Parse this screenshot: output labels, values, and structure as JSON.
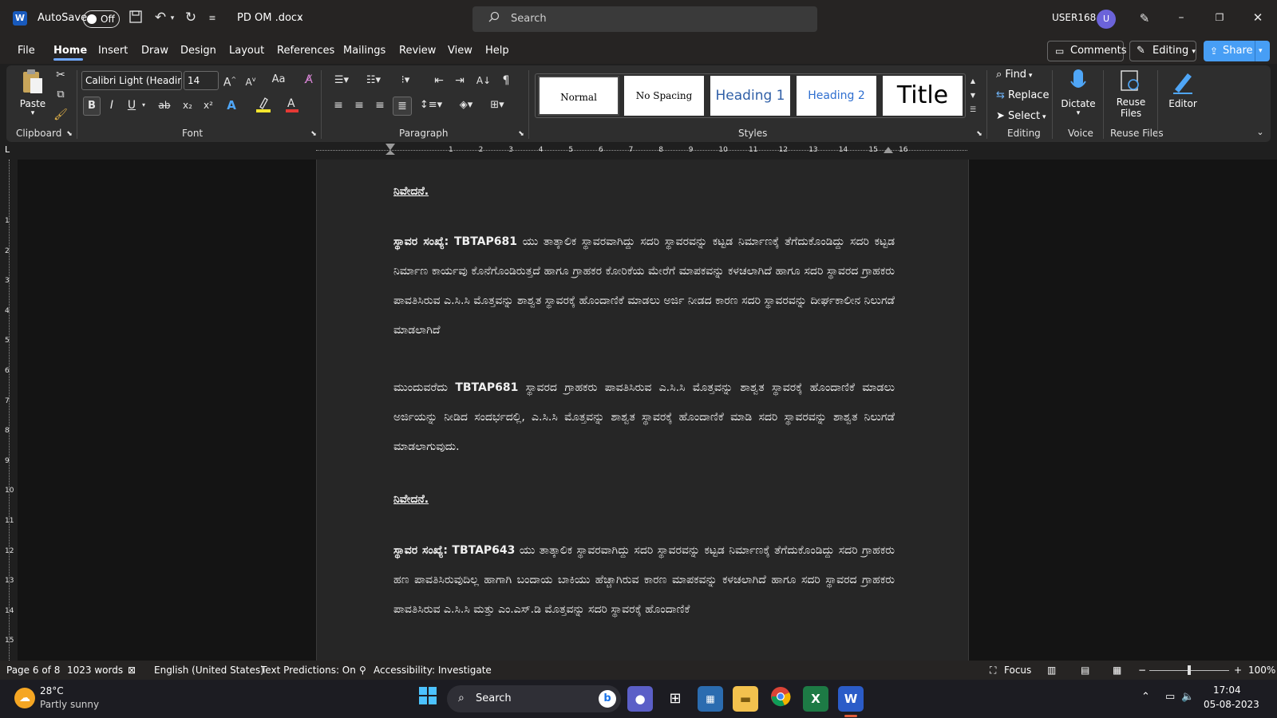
{
  "titlebar": {
    "autosave_label": "AutoSave",
    "autosave_state": "Off",
    "doc_title": "PD OM .docx",
    "search_placeholder": "Search",
    "user": "USER168",
    "avatar_initial": "U"
  },
  "tabs": [
    "File",
    "Home",
    "Insert",
    "Draw",
    "Design",
    "Layout",
    "References",
    "Mailings",
    "Review",
    "View",
    "Help"
  ],
  "active_tab": "Home",
  "top_buttons": {
    "comments": "Comments",
    "editing": "Editing",
    "share": "Share"
  },
  "ribbon": {
    "clipboard": {
      "paste": "Paste",
      "group": "Clipboard"
    },
    "font": {
      "name": "Calibri Light (Headir",
      "size": "14",
      "group": "Font",
      "bold": "B",
      "italic": "I",
      "underline": "U",
      "strike": "ab",
      "sub": "x₂",
      "sup": "x²",
      "aa": "Aa"
    },
    "paragraph": {
      "group": "Paragraph"
    },
    "styles": {
      "items": [
        "Normal",
        "No Spacing",
        "Heading 1",
        "Heading 2",
        "Title"
      ],
      "group": "Styles"
    },
    "editing": {
      "find": "Find",
      "replace": "Replace",
      "select": "Select",
      "group": "Editing"
    },
    "voice": {
      "dictate": "Dictate",
      "group": "Voice"
    },
    "reuse": {
      "label1": "Reuse",
      "label2": "Files",
      "group": "Reuse Files"
    },
    "editor": {
      "label": "Editor"
    }
  },
  "ruler": {
    "numbers": [
      "1",
      "2",
      "3",
      "4",
      "5",
      "6",
      "7",
      "8",
      "9",
      "10",
      "11",
      "12",
      "13",
      "14",
      "15",
      "16"
    ],
    "vnumbers": [
      "1",
      "2",
      "3",
      "4",
      "5",
      "6",
      "7",
      "8",
      "9",
      "10",
      "11",
      "12",
      "13",
      "14",
      "15"
    ]
  },
  "document": {
    "heading1": "ನಿವೇದನೆ.",
    "para1_lead": "ಸ್ಥಾವರ ಸಂಖ್ಯೆ:",
    "para1_code": "TBTAP681",
    "para1_text": "ಯು ತಾತ್ಕಾಲಿಕ ಸ್ಥಾವರವಾಗಿದ್ದು ಸದರಿ ಸ್ಥಾವರವನ್ನು ಕಟ್ಟಡ ನಿರ್ಮಾಣಕ್ಕೆ ತೆಗೆದುಕೊಂಡಿದ್ದು ಸದರಿ ಕಟ್ಟಡ ನಿರ್ಮಾಣ ಕಾರ್ಯವು ಕೊನೆಗೊಂಡಿರುತ್ತದೆ ಹಾಗೂ ಗ್ರಾಹಕರ ಕೋರಿಕೆಯ ಮೇರೆಗೆ ಮಾಪಕವನ್ನು ಕಳಚಲಾಗಿದೆ ಹಾಗೂ ಸದರಿ ಸ್ಥಾವರದ ಗ್ರಾಹಕರು ಪಾವತಿಸಿರುವ ಎ.ಸಿ.ಸಿ ಮೊತ್ತವನ್ನು ಶಾಶ್ವತ ಸ್ಥಾವರಕ್ಕೆ ಹೊಂದಾಣಿಕೆ ಮಾಡಲು ಅರ್ಜಿ ನೀಡದ ಕಾರಣ ಸದರಿ ಸ್ಥಾವರವನ್ನು ದೀರ್ಘಕಾಲೀನ ನಿಲುಗಡೆ ಮಾಡಲಾಗಿದೆ",
    "para2_lead": "ಮುಂದುವರೆದು",
    "para2_code": "TBTAP681",
    "para2_text": "ಸ್ಥಾವರದ ಗ್ರಾಹಕರು ಪಾವತಿಸಿರುವ ಎ.ಸಿ.ಸಿ ಮೊತ್ತವನ್ನು ಶಾಶ್ವತ ಸ್ಥಾವರಕ್ಕೆ ಹೊಂದಾಣಿಕೆ ಮಾಡಲು ಅರ್ಜಿಯನ್ನು ನೀಡಿದ ಸಂದರ್ಭದಲ್ಲಿ, ಎ.ಸಿ.ಸಿ ಮೊತ್ತವನ್ನು ಶಾಶ್ವತ ಸ್ಥಾವರಕ್ಕೆ ಹೊಂದಾಣಿಕೆ ಮಾಡಿ ಸದರಿ ಸ್ಥಾವರವನ್ನು ಶಾಶ್ವತ ನಿಲುಗಡೆ ಮಾಡಲಾಗುವುದು.",
    "heading2": "ನಿವೇದನೆ.",
    "para3_lead": "ಸ್ಥಾವರ ಸಂಖ್ಯೆ:",
    "para3_code": "TBTAP643",
    "para3_text": "ಯು ತಾತ್ಕಾಲಿಕ ಸ್ಥಾವರವಾಗಿದ್ದು ಸದರಿ ಸ್ಥಾವರವನ್ನು ಕಟ್ಟಡ ನಿರ್ಮಾಣಕ್ಕೆ ತೆಗೆದುಕೊಂಡಿದ್ದು ಸದರಿ ಗ್ರಾಹಕರು ಹಣ ಪಾವತಿಸಿರುವುದಿಲ್ಲ ಹಾಗಾಗಿ ಬಂದಾಯ ಬಾಕಿಯು ಹೆಚ್ಚಾಗಿರುವ ಕಾರಣ ಮಾಪಕವನ್ನು ಕಳಚಲಾಗಿದೆ ಹಾಗೂ ಸದರಿ ಸ್ಥಾವರದ ಗ್ರಾಹಕರು ಪಾವತಿಸಿರುವ ಎ.ಸಿ.ಸಿ ಮತ್ತು ಎಂ.ಎಸ್.ಡಿ ಮೊತ್ತವನ್ನು ಸದರಿ ಸ್ಥಾವರಕ್ಕೆ ಹೊಂದಾಣಿಕೆ"
  },
  "status": {
    "page": "Page 6 of 8",
    "words": "1023 words",
    "language": "English (United States)",
    "predictions": "Text Predictions: On",
    "accessibility": "Accessibility: Investigate",
    "focus": "Focus",
    "zoom": "100%"
  },
  "taskbar": {
    "temp": "28°C",
    "weather": "Partly sunny",
    "search": "Search",
    "time": "17:04",
    "date": "05-08-2023"
  }
}
